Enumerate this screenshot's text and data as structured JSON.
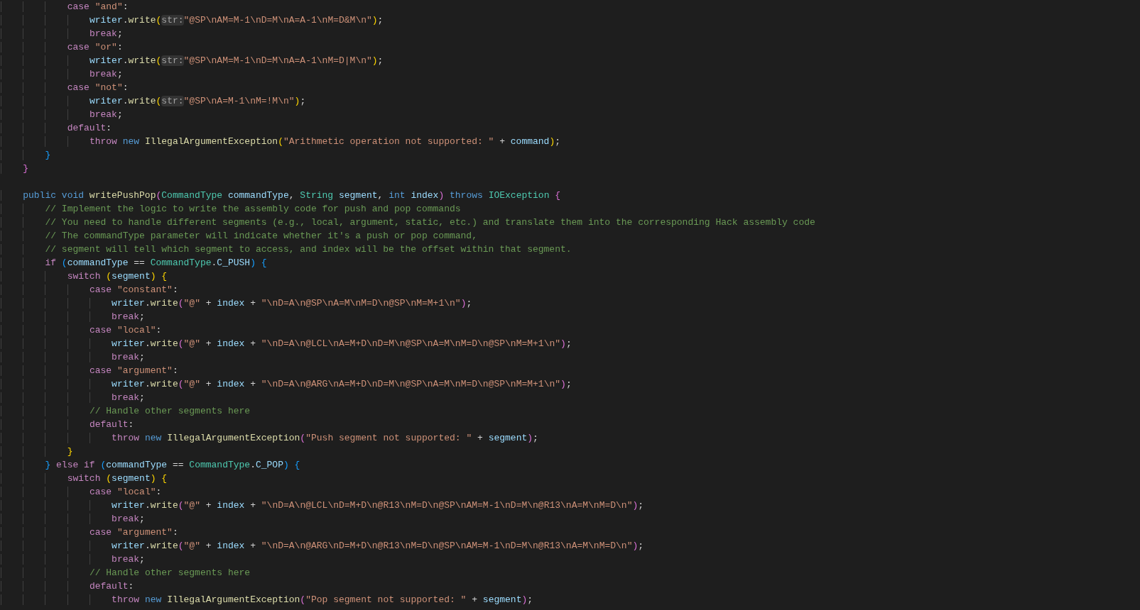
{
  "editor": {
    "lines": [
      {
        "kind": "offscreen",
        "children": [
          {
            "kind": "offscreen",
            "children": [
              {
                "kind": "code",
                "tokens": [
                  {
                    "kind": "ctl",
                    "text": "case "
                  },
                  {
                    "kind": "str",
                    "text": "\"and\""
                  },
                  {
                    "kind": "p",
                    "text": ":"
                  }
                ],
                "children": [
                  {
                    "kind": "code",
                    "tokens": [
                      {
                        "kind": "var",
                        "text": "writer"
                      },
                      {
                        "kind": "p",
                        "text": "."
                      },
                      {
                        "kind": "fn",
                        "text": "write"
                      },
                      {
                        "kind": "bracket1",
                        "text": "("
                      },
                      {
                        "kind": "hint",
                        "text": "str:"
                      },
                      {
                        "kind": "str",
                        "text": "\"@SP\\nAM=M-1\\nD=M\\nA=A-1\\nM=D&M\\n\""
                      },
                      {
                        "kind": "bracket1",
                        "text": ")"
                      },
                      {
                        "kind": "p",
                        "text": ";"
                      }
                    ]
                  },
                  {
                    "kind": "code",
                    "tokens": [
                      {
                        "kind": "ctl",
                        "text": "break"
                      },
                      {
                        "kind": "p",
                        "text": ";"
                      }
                    ]
                  }
                ]
              },
              {
                "kind": "code",
                "tokens": [
                  {
                    "kind": "ctl",
                    "text": "case "
                  },
                  {
                    "kind": "str",
                    "text": "\"or\""
                  },
                  {
                    "kind": "p",
                    "text": ":"
                  }
                ],
                "children": [
                  {
                    "kind": "code",
                    "tokens": [
                      {
                        "kind": "var",
                        "text": "writer"
                      },
                      {
                        "kind": "p",
                        "text": "."
                      },
                      {
                        "kind": "fn",
                        "text": "write"
                      },
                      {
                        "kind": "bracket1",
                        "text": "("
                      },
                      {
                        "kind": "hint",
                        "text": "str:"
                      },
                      {
                        "kind": "str",
                        "text": "\"@SP\\nAM=M-1\\nD=M\\nA=A-1\\nM=D|M\\n\""
                      },
                      {
                        "kind": "bracket1",
                        "text": ")"
                      },
                      {
                        "kind": "p",
                        "text": ";"
                      }
                    ]
                  },
                  {
                    "kind": "code",
                    "tokens": [
                      {
                        "kind": "ctl",
                        "text": "break"
                      },
                      {
                        "kind": "p",
                        "text": ";"
                      }
                    ]
                  }
                ]
              },
              {
                "kind": "code",
                "tokens": [
                  {
                    "kind": "ctl",
                    "text": "case "
                  },
                  {
                    "kind": "str",
                    "text": "\"not\""
                  },
                  {
                    "kind": "p",
                    "text": ":"
                  }
                ],
                "children": [
                  {
                    "kind": "code",
                    "tokens": [
                      {
                        "kind": "var",
                        "text": "writer"
                      },
                      {
                        "kind": "p",
                        "text": "."
                      },
                      {
                        "kind": "fn",
                        "text": "write"
                      },
                      {
                        "kind": "bracket1",
                        "text": "("
                      },
                      {
                        "kind": "hint",
                        "text": "str:"
                      },
                      {
                        "kind": "str",
                        "text": "\"@SP\\nA=M-1\\nM=!M\\n\""
                      },
                      {
                        "kind": "bracket1",
                        "text": ")"
                      },
                      {
                        "kind": "p",
                        "text": ";"
                      }
                    ]
                  },
                  {
                    "kind": "code",
                    "tokens": [
                      {
                        "kind": "ctl",
                        "text": "break"
                      },
                      {
                        "kind": "p",
                        "text": ";"
                      }
                    ]
                  }
                ]
              },
              {
                "kind": "code",
                "tokens": [
                  {
                    "kind": "ctl",
                    "text": "default"
                  },
                  {
                    "kind": "p",
                    "text": ":"
                  }
                ],
                "children": [
                  {
                    "kind": "code",
                    "tokens": [
                      {
                        "kind": "ctl",
                        "text": "throw "
                      },
                      {
                        "kind": "kw",
                        "text": "new "
                      },
                      {
                        "kind": "fn",
                        "text": "IllegalArgumentException"
                      },
                      {
                        "kind": "bracket1",
                        "text": "("
                      },
                      {
                        "kind": "str",
                        "text": "\"Arithmetic operation not supported: \""
                      },
                      {
                        "kind": "p",
                        "text": " + "
                      },
                      {
                        "kind": "var",
                        "text": "command"
                      },
                      {
                        "kind": "bracket1",
                        "text": ")"
                      },
                      {
                        "kind": "p",
                        "text": ";"
                      }
                    ]
                  }
                ]
              }
            ]
          },
          {
            "kind": "code",
            "tokens": [
              {
                "kind": "bracket3",
                "text": "}"
              }
            ]
          }
        ]
      },
      {
        "kind": "code",
        "tokens": [
          {
            "kind": "bracket2",
            "text": "}"
          }
        ]
      },
      {
        "kind": "blank"
      },
      {
        "kind": "code",
        "tokens": [
          {
            "kind": "kw",
            "text": "public "
          },
          {
            "kind": "kw",
            "text": "void "
          },
          {
            "kind": "fn",
            "text": "writePushPop"
          },
          {
            "kind": "bracket2",
            "text": "("
          },
          {
            "kind": "type",
            "text": "CommandType "
          },
          {
            "kind": "var",
            "text": "commandType"
          },
          {
            "kind": "p",
            "text": ", "
          },
          {
            "kind": "type",
            "text": "String "
          },
          {
            "kind": "var",
            "text": "segment"
          },
          {
            "kind": "p",
            "text": ", "
          },
          {
            "kind": "kw",
            "text": "int "
          },
          {
            "kind": "var",
            "text": "index"
          },
          {
            "kind": "bracket2",
            "text": ") "
          },
          {
            "kind": "kw",
            "text": "throws "
          },
          {
            "kind": "type",
            "text": "IOException "
          },
          {
            "kind": "bracket2",
            "text": "{"
          }
        ],
        "children": [
          {
            "kind": "code",
            "tokens": [
              {
                "kind": "comment",
                "text": "// Implement the logic to write the assembly code for push and pop commands"
              }
            ]
          },
          {
            "kind": "code",
            "tokens": [
              {
                "kind": "comment",
                "text": "// You need to handle different segments (e.g., local, argument, static, etc.) and translate them into the corresponding Hack assembly code"
              }
            ]
          },
          {
            "kind": "code",
            "tokens": [
              {
                "kind": "comment",
                "text": "// The commandType parameter will indicate whether it's a push or pop command,"
              }
            ]
          },
          {
            "kind": "code",
            "tokens": [
              {
                "kind": "comment",
                "text": "// segment will tell which segment to access, and index will be the offset within that segment."
              }
            ]
          },
          {
            "kind": "code",
            "tokens": [
              {
                "kind": "ctl",
                "text": "if "
              },
              {
                "kind": "bracket3",
                "text": "("
              },
              {
                "kind": "var",
                "text": "commandType"
              },
              {
                "kind": "p",
                "text": " == "
              },
              {
                "kind": "type",
                "text": "CommandType"
              },
              {
                "kind": "p",
                "text": "."
              },
              {
                "kind": "var",
                "text": "C_PUSH"
              },
              {
                "kind": "bracket3",
                "text": ") "
              },
              {
                "kind": "bracket3",
                "text": "{"
              }
            ],
            "children": [
              {
                "kind": "code",
                "tokens": [
                  {
                    "kind": "ctl",
                    "text": "switch "
                  },
                  {
                    "kind": "bracket1",
                    "text": "("
                  },
                  {
                    "kind": "var",
                    "text": "segment"
                  },
                  {
                    "kind": "bracket1",
                    "text": ") "
                  },
                  {
                    "kind": "bracket1",
                    "text": "{"
                  }
                ],
                "children": [
                  {
                    "kind": "code",
                    "tokens": [
                      {
                        "kind": "ctl",
                        "text": "case "
                      },
                      {
                        "kind": "str",
                        "text": "\"constant\""
                      },
                      {
                        "kind": "p",
                        "text": ":"
                      }
                    ],
                    "children": [
                      {
                        "kind": "code",
                        "tokens": [
                          {
                            "kind": "var",
                            "text": "writer"
                          },
                          {
                            "kind": "p",
                            "text": "."
                          },
                          {
                            "kind": "fn",
                            "text": "write"
                          },
                          {
                            "kind": "bracket2",
                            "text": "("
                          },
                          {
                            "kind": "str",
                            "text": "\"@\""
                          },
                          {
                            "kind": "p",
                            "text": " + "
                          },
                          {
                            "kind": "var",
                            "text": "index"
                          },
                          {
                            "kind": "p",
                            "text": " + "
                          },
                          {
                            "kind": "str",
                            "text": "\"\\nD=A\\n@SP\\nA=M\\nM=D\\n@SP\\nM=M+1\\n\""
                          },
                          {
                            "kind": "bracket2",
                            "text": ")"
                          },
                          {
                            "kind": "p",
                            "text": ";"
                          }
                        ]
                      },
                      {
                        "kind": "code",
                        "tokens": [
                          {
                            "kind": "ctl",
                            "text": "break"
                          },
                          {
                            "kind": "p",
                            "text": ";"
                          }
                        ]
                      }
                    ]
                  },
                  {
                    "kind": "code",
                    "tokens": [
                      {
                        "kind": "ctl",
                        "text": "case "
                      },
                      {
                        "kind": "str",
                        "text": "\"local\""
                      },
                      {
                        "kind": "p",
                        "text": ":"
                      }
                    ],
                    "children": [
                      {
                        "kind": "code",
                        "tokens": [
                          {
                            "kind": "var",
                            "text": "writer"
                          },
                          {
                            "kind": "p",
                            "text": "."
                          },
                          {
                            "kind": "fn",
                            "text": "write"
                          },
                          {
                            "kind": "bracket2",
                            "text": "("
                          },
                          {
                            "kind": "str",
                            "text": "\"@\""
                          },
                          {
                            "kind": "p",
                            "text": " + "
                          },
                          {
                            "kind": "var",
                            "text": "index"
                          },
                          {
                            "kind": "p",
                            "text": " + "
                          },
                          {
                            "kind": "str",
                            "text": "\"\\nD=A\\n@LCL\\nA=M+D\\nD=M\\n@SP\\nA=M\\nM=D\\n@SP\\nM=M+1\\n\""
                          },
                          {
                            "kind": "bracket2",
                            "text": ")"
                          },
                          {
                            "kind": "p",
                            "text": ";"
                          }
                        ]
                      },
                      {
                        "kind": "code",
                        "tokens": [
                          {
                            "kind": "ctl",
                            "text": "break"
                          },
                          {
                            "kind": "p",
                            "text": ";"
                          }
                        ]
                      }
                    ]
                  },
                  {
                    "kind": "code",
                    "tokens": [
                      {
                        "kind": "ctl",
                        "text": "case "
                      },
                      {
                        "kind": "str",
                        "text": "\"argument\""
                      },
                      {
                        "kind": "p",
                        "text": ":"
                      }
                    ],
                    "children": [
                      {
                        "kind": "code",
                        "tokens": [
                          {
                            "kind": "var",
                            "text": "writer"
                          },
                          {
                            "kind": "p",
                            "text": "."
                          },
                          {
                            "kind": "fn",
                            "text": "write"
                          },
                          {
                            "kind": "bracket2",
                            "text": "("
                          },
                          {
                            "kind": "str",
                            "text": "\"@\""
                          },
                          {
                            "kind": "p",
                            "text": " + "
                          },
                          {
                            "kind": "var",
                            "text": "index"
                          },
                          {
                            "kind": "p",
                            "text": " + "
                          },
                          {
                            "kind": "str",
                            "text": "\"\\nD=A\\n@ARG\\nA=M+D\\nD=M\\n@SP\\nA=M\\nM=D\\n@SP\\nM=M+1\\n\""
                          },
                          {
                            "kind": "bracket2",
                            "text": ")"
                          },
                          {
                            "kind": "p",
                            "text": ";"
                          }
                        ]
                      },
                      {
                        "kind": "code",
                        "tokens": [
                          {
                            "kind": "ctl",
                            "text": "break"
                          },
                          {
                            "kind": "p",
                            "text": ";"
                          }
                        ]
                      }
                    ]
                  },
                  {
                    "kind": "code",
                    "tokens": [
                      {
                        "kind": "comment",
                        "text": "// Handle other segments here"
                      }
                    ]
                  },
                  {
                    "kind": "code",
                    "tokens": [
                      {
                        "kind": "ctl",
                        "text": "default"
                      },
                      {
                        "kind": "p",
                        "text": ":"
                      }
                    ],
                    "children": [
                      {
                        "kind": "code",
                        "tokens": [
                          {
                            "kind": "ctl",
                            "text": "throw "
                          },
                          {
                            "kind": "kw",
                            "text": "new "
                          },
                          {
                            "kind": "fn",
                            "text": "IllegalArgumentException"
                          },
                          {
                            "kind": "bracket2",
                            "text": "("
                          },
                          {
                            "kind": "str",
                            "text": "\"Push segment not supported: \""
                          },
                          {
                            "kind": "p",
                            "text": " + "
                          },
                          {
                            "kind": "var",
                            "text": "segment"
                          },
                          {
                            "kind": "bracket2",
                            "text": ")"
                          },
                          {
                            "kind": "p",
                            "text": ";"
                          }
                        ]
                      }
                    ]
                  }
                ]
              },
              {
                "kind": "code",
                "tokens": [
                  {
                    "kind": "bracket1",
                    "text": "}"
                  }
                ]
              }
            ]
          },
          {
            "kind": "code",
            "tokens": [
              {
                "kind": "bracket3",
                "text": "} "
              },
              {
                "kind": "ctl",
                "text": "else "
              },
              {
                "kind": "ctl",
                "text": "if "
              },
              {
                "kind": "bracket3",
                "text": "("
              },
              {
                "kind": "var",
                "text": "commandType"
              },
              {
                "kind": "p",
                "text": " == "
              },
              {
                "kind": "type",
                "text": "CommandType"
              },
              {
                "kind": "p",
                "text": "."
              },
              {
                "kind": "var",
                "text": "C_POP"
              },
              {
                "kind": "bracket3",
                "text": ") "
              },
              {
                "kind": "bracket3",
                "text": "{"
              }
            ],
            "children": [
              {
                "kind": "code",
                "tokens": [
                  {
                    "kind": "ctl",
                    "text": "switch "
                  },
                  {
                    "kind": "bracket1",
                    "text": "("
                  },
                  {
                    "kind": "var",
                    "text": "segment"
                  },
                  {
                    "kind": "bracket1",
                    "text": ") "
                  },
                  {
                    "kind": "bracket1",
                    "text": "{"
                  }
                ],
                "children": [
                  {
                    "kind": "code",
                    "tokens": [
                      {
                        "kind": "ctl",
                        "text": "case "
                      },
                      {
                        "kind": "str",
                        "text": "\"local\""
                      },
                      {
                        "kind": "p",
                        "text": ":"
                      }
                    ],
                    "children": [
                      {
                        "kind": "code",
                        "tokens": [
                          {
                            "kind": "var",
                            "text": "writer"
                          },
                          {
                            "kind": "p",
                            "text": "."
                          },
                          {
                            "kind": "fn",
                            "text": "write"
                          },
                          {
                            "kind": "bracket2",
                            "text": "("
                          },
                          {
                            "kind": "str",
                            "text": "\"@\""
                          },
                          {
                            "kind": "p",
                            "text": " + "
                          },
                          {
                            "kind": "var",
                            "text": "index"
                          },
                          {
                            "kind": "p",
                            "text": " + "
                          },
                          {
                            "kind": "str",
                            "text": "\"\\nD=A\\n@LCL\\nD=M+D\\n@R13\\nM=D\\n@SP\\nAM=M-1\\nD=M\\n@R13\\nA=M\\nM=D\\n\""
                          },
                          {
                            "kind": "bracket2",
                            "text": ")"
                          },
                          {
                            "kind": "p",
                            "text": ";"
                          }
                        ]
                      },
                      {
                        "kind": "code",
                        "tokens": [
                          {
                            "kind": "ctl",
                            "text": "break"
                          },
                          {
                            "kind": "p",
                            "text": ";"
                          }
                        ]
                      }
                    ]
                  },
                  {
                    "kind": "code",
                    "tokens": [
                      {
                        "kind": "ctl",
                        "text": "case "
                      },
                      {
                        "kind": "str",
                        "text": "\"argument\""
                      },
                      {
                        "kind": "p",
                        "text": ":"
                      }
                    ],
                    "children": [
                      {
                        "kind": "code",
                        "tokens": [
                          {
                            "kind": "var",
                            "text": "writer"
                          },
                          {
                            "kind": "p",
                            "text": "."
                          },
                          {
                            "kind": "fn",
                            "text": "write"
                          },
                          {
                            "kind": "bracket2",
                            "text": "("
                          },
                          {
                            "kind": "str",
                            "text": "\"@\""
                          },
                          {
                            "kind": "p",
                            "text": " + "
                          },
                          {
                            "kind": "var",
                            "text": "index"
                          },
                          {
                            "kind": "p",
                            "text": " + "
                          },
                          {
                            "kind": "str",
                            "text": "\"\\nD=A\\n@ARG\\nD=M+D\\n@R13\\nM=D\\n@SP\\nAM=M-1\\nD=M\\n@R13\\nA=M\\nM=D\\n\""
                          },
                          {
                            "kind": "bracket2",
                            "text": ")"
                          },
                          {
                            "kind": "p",
                            "text": ";"
                          }
                        ]
                      },
                      {
                        "kind": "code",
                        "tokens": [
                          {
                            "kind": "ctl",
                            "text": "break"
                          },
                          {
                            "kind": "p",
                            "text": ";"
                          }
                        ]
                      }
                    ]
                  },
                  {
                    "kind": "code",
                    "tokens": [
                      {
                        "kind": "comment",
                        "text": "// Handle other segments here"
                      }
                    ]
                  },
                  {
                    "kind": "code",
                    "tokens": [
                      {
                        "kind": "ctl",
                        "text": "default"
                      },
                      {
                        "kind": "p",
                        "text": ":"
                      }
                    ],
                    "children": [
                      {
                        "kind": "code",
                        "tokens": [
                          {
                            "kind": "ctl",
                            "text": "throw "
                          },
                          {
                            "kind": "kw",
                            "text": "new "
                          },
                          {
                            "kind": "fn",
                            "text": "IllegalArgumentException"
                          },
                          {
                            "kind": "bracket2",
                            "text": "("
                          },
                          {
                            "kind": "str",
                            "text": "\"Pop segment not supported: \""
                          },
                          {
                            "kind": "p",
                            "text": " + "
                          },
                          {
                            "kind": "var",
                            "text": "segment"
                          },
                          {
                            "kind": "bracket2",
                            "text": ")"
                          },
                          {
                            "kind": "p",
                            "text": ";"
                          }
                        ]
                      }
                    ]
                  }
                ]
              }
            ]
          }
        ]
      }
    ]
  }
}
